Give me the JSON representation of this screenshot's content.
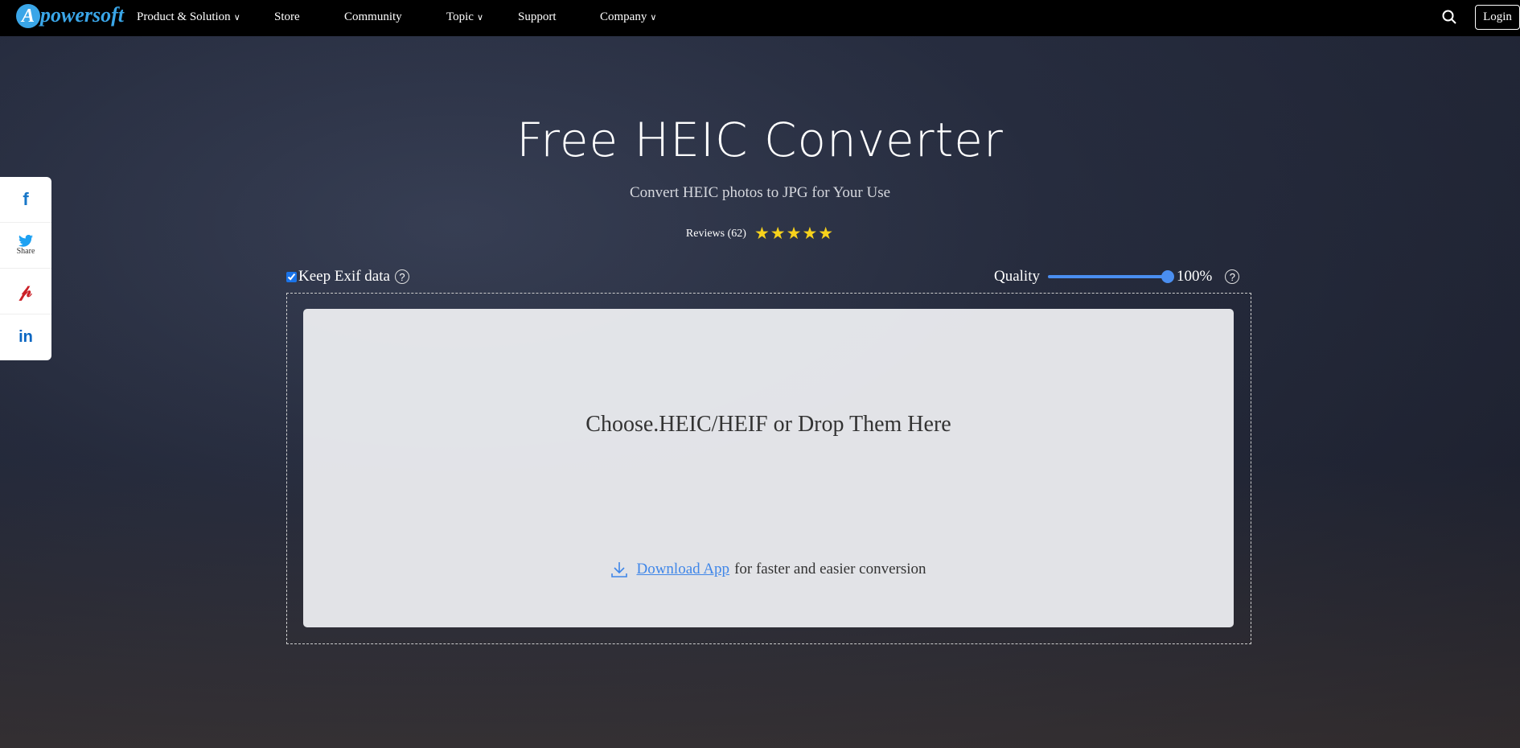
{
  "nav": {
    "logo": "Apowersoft",
    "items": [
      {
        "label": "Product & Solution",
        "dropdown": true
      },
      {
        "label": "Store"
      },
      {
        "label": "Community"
      },
      {
        "label": "Topic",
        "dropdown": true
      },
      {
        "label": "Support"
      },
      {
        "label": "Company",
        "dropdown": true
      }
    ],
    "login": "Login"
  },
  "hero": {
    "title": "Free HEIC Converter",
    "subtitle": "Convert HEIC photos to JPG for Your Use",
    "reviews": "Reviews (62)",
    "rating": 5
  },
  "options": {
    "keep_exif_label": "Keep Exif data",
    "keep_exif_checked": true,
    "quality_label": "Quality",
    "quality_value": "100%",
    "quality_percent": 100
  },
  "dropzone": {
    "text": "Choose.HEIC/HEIF or Drop Them Here",
    "download_link": "Download App",
    "download_suffix": "for faster and easier conversion"
  },
  "social": {
    "share_label": "Share",
    "items": [
      "facebook",
      "twitter",
      "pinterest",
      "linkedin"
    ]
  },
  "colors": {
    "accent": "#4a8ef0",
    "star": "#f7d21c",
    "facebook": "#1877c8",
    "twitter": "#1da1f2",
    "pinterest": "#cb2027",
    "linkedin": "#0a66c2"
  }
}
